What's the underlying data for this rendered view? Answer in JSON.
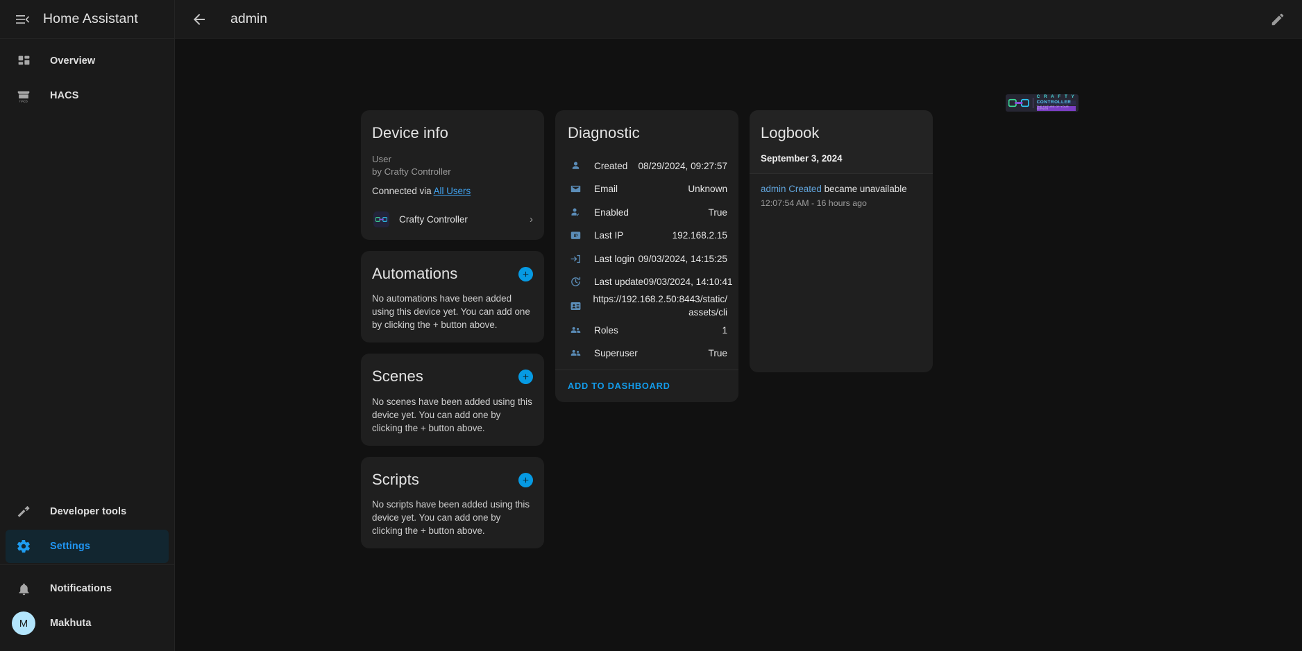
{
  "sidebar": {
    "title": "Home Assistant",
    "menu_icon": "hamburger-collapse-icon",
    "items": [
      {
        "label": "Overview",
        "icon": "dashboard-icon"
      },
      {
        "label": "HACS",
        "icon": "hacs-storefront-icon"
      }
    ],
    "bottom_items": [
      {
        "label": "Developer tools",
        "icon": "hammer-icon"
      },
      {
        "label": "Settings",
        "icon": "gear-icon",
        "selected": true
      }
    ],
    "footer_items": [
      {
        "label": "Notifications",
        "icon": "bell-icon"
      },
      {
        "label": "Makhuta",
        "icon": "avatar",
        "initial": "M"
      }
    ]
  },
  "toolbar": {
    "back_icon": "arrow-left-icon",
    "title": "admin",
    "edit_icon": "pencil-icon"
  },
  "brand": {
    "line1": "C R A F T Y",
    "line2": "CONTROLLER",
    "line3": "THE FUTURE OF YOUR SERVER"
  },
  "device_info": {
    "title": "Device info",
    "model": "User",
    "by": "by Crafty Controller",
    "connected_prefix": "Connected via ",
    "connected_link": "All Users",
    "via_device": "Crafty Controller",
    "chevron": "›"
  },
  "automations": {
    "title": "Automations",
    "add_icon": "plus-icon",
    "empty": "No automations have been added using this device yet. You can add one by clicking the + button above."
  },
  "scenes": {
    "title": "Scenes",
    "add_icon": "plus-icon",
    "empty": "No scenes have been added using this device yet. You can add one by clicking the + button above."
  },
  "scripts": {
    "title": "Scripts",
    "add_icon": "plus-icon",
    "empty": "No scripts have been added using this device yet. You can add one by clicking the + button above."
  },
  "diagnostic": {
    "title": "Diagnostic",
    "rows": [
      {
        "icon": "account-icon",
        "key": "Created",
        "value": "08/29/2024, 09:27:57"
      },
      {
        "icon": "email-icon",
        "key": "Email",
        "value": "Unknown"
      },
      {
        "icon": "account-check-icon",
        "key": "Enabled",
        "value": "True"
      },
      {
        "icon": "ip-icon",
        "key": "Last IP",
        "value": "192.168.2.15"
      },
      {
        "icon": "login-icon",
        "key": "Last login",
        "value": "09/03/2024, 14:15:25"
      },
      {
        "icon": "clock-refresh-icon",
        "key": "Last update",
        "value": "09/03/2024, 14:10:41"
      },
      {
        "icon": "id-card-icon",
        "key": "",
        "value": "https://192.168.2.50:8443/static/assets/cli"
      },
      {
        "icon": "account-group-icon",
        "key": "Roles",
        "value": "1"
      },
      {
        "icon": "account-group-icon",
        "key": "Superuser",
        "value": "True"
      }
    ],
    "add_to_dashboard": "ADD TO DASHBOARD"
  },
  "logbook": {
    "title": "Logbook",
    "date": "September 3, 2024",
    "entries": [
      {
        "entity": "admin Created",
        "message": " became unavailable",
        "time": "12:07:54 AM - 16 hours ago"
      }
    ]
  },
  "colors": {
    "accent": "#03a9f4",
    "link": "#41a6f5",
    "selected_bg": "#122630",
    "card_bg": "#1f1f1f",
    "page_bg": "#111111",
    "sidebar_bg": "#1a1a1a"
  }
}
